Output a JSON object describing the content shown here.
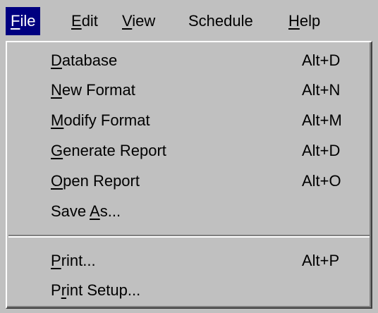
{
  "menubar": {
    "items": [
      {
        "label": "File",
        "mnemonic": "F",
        "rest": "ile",
        "active": true
      },
      {
        "label": "Edit",
        "mnemonic": "E",
        "rest": "dit"
      },
      {
        "label": "View",
        "mnemonic": "V",
        "rest": "iew"
      },
      {
        "label": "Schedule",
        "mnemonic": "",
        "rest": "Schedule"
      },
      {
        "label": "Help",
        "mnemonic": "H",
        "rest": "elp"
      }
    ]
  },
  "file_menu": {
    "items": [
      {
        "label": "Database",
        "pre": "",
        "mnemonic": "D",
        "post": "atabase",
        "shortcut": "Alt+D"
      },
      {
        "label": "New Format",
        "pre": "",
        "mnemonic": "N",
        "post": "ew Format",
        "shortcut": "Alt+N"
      },
      {
        "label": "Modify Format",
        "pre": "",
        "mnemonic": "M",
        "post": "odify Format",
        "shortcut": "Alt+M"
      },
      {
        "label": "Generate Report",
        "pre": "",
        "mnemonic": "G",
        "post": "enerate Report",
        "shortcut": "Alt+D"
      },
      {
        "label": "Open Report",
        "pre": "",
        "mnemonic": "O",
        "post": "pen Report",
        "shortcut": "Alt+O"
      },
      {
        "label": "Save As...",
        "pre": "Save ",
        "mnemonic": "A",
        "post": "s...",
        "shortcut": ""
      },
      {
        "label": "Print...",
        "pre": "",
        "mnemonic": "P",
        "post": "rint...",
        "shortcut": "Alt+P"
      },
      {
        "label": "Print Setup...",
        "pre": "P",
        "mnemonic": "r",
        "post": "int Setup...",
        "shortcut": ""
      }
    ]
  },
  "colors": {
    "menu_bg": "#c0c0c0",
    "highlight_bg": "#000080",
    "highlight_text": "#ffffff"
  }
}
